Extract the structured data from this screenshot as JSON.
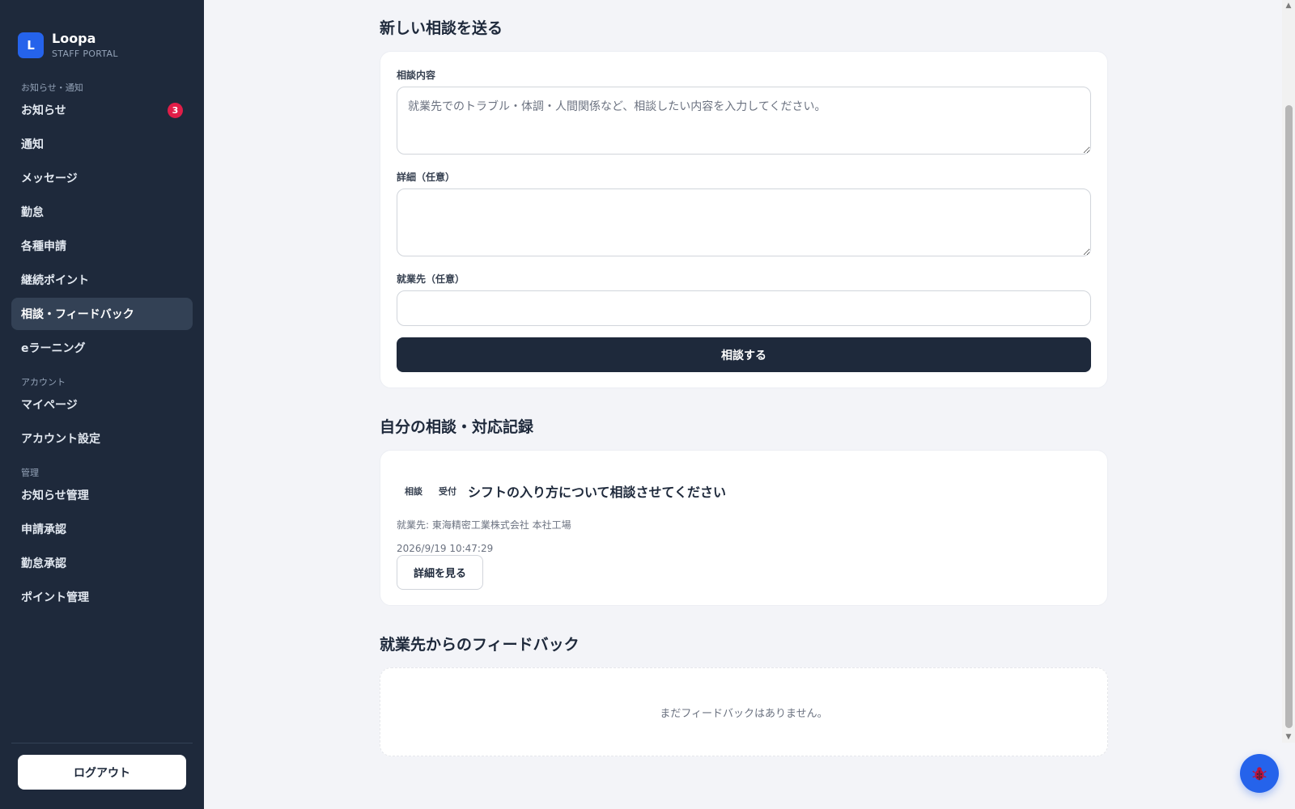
{
  "brand": {
    "logo_letter": "L",
    "name": "Loopa",
    "subtitle": "STAFF PORTAL"
  },
  "sidebar": {
    "sections": [
      {
        "label": "お知らせ・通知",
        "items": [
          {
            "label": "お知らせ",
            "badge": "3"
          },
          {
            "label": "通知"
          },
          {
            "label": "メッセージ"
          },
          {
            "label": "勤怠"
          },
          {
            "label": "各種申請"
          },
          {
            "label": "継続ポイント"
          },
          {
            "label": "相談・フィードバック",
            "active": true
          },
          {
            "label": "eラーニング"
          }
        ]
      },
      {
        "label": "アカウント",
        "items": [
          {
            "label": "マイページ"
          },
          {
            "label": "アカウント設定"
          }
        ]
      },
      {
        "label": "管理",
        "items": [
          {
            "label": "お知らせ管理"
          },
          {
            "label": "申請承認"
          },
          {
            "label": "勤怠承認"
          },
          {
            "label": "ポイント管理"
          }
        ]
      }
    ],
    "logout_label": "ログアウト"
  },
  "new_consultation": {
    "title": "新しい相談を送る",
    "content_label": "相談内容",
    "content_placeholder": "就業先でのトラブル・体調・人間関係など、相談したい内容を入力してください。",
    "content_value": "",
    "detail_label": "詳細（任意）",
    "detail_value": "",
    "workplace_label": "就業先（任意）",
    "workplace_value": "",
    "submit_label": "相談する"
  },
  "records": {
    "title": "自分の相談・対応記録",
    "items": [
      {
        "category": "相談",
        "status": "受付",
        "title": "シフトの入り方について相談させてください",
        "workplace": "就業先: 東海精密工業株式会社 本社工場",
        "datetime": "2026/9/19 10:47:29",
        "detail_button": "詳細を見る"
      }
    ]
  },
  "feedback": {
    "title": "就業先からのフィードバック",
    "empty_message": "まだフィードバックはありません。"
  },
  "colors": {
    "sidebar_bg": "#1e293b",
    "accent": "#2563eb",
    "badge": "#e11d48",
    "primary_button": "#1e293b"
  },
  "icons": {
    "fab": "bug-icon",
    "scroll_up": "arrow-up-icon",
    "scroll_down": "arrow-down-icon"
  }
}
